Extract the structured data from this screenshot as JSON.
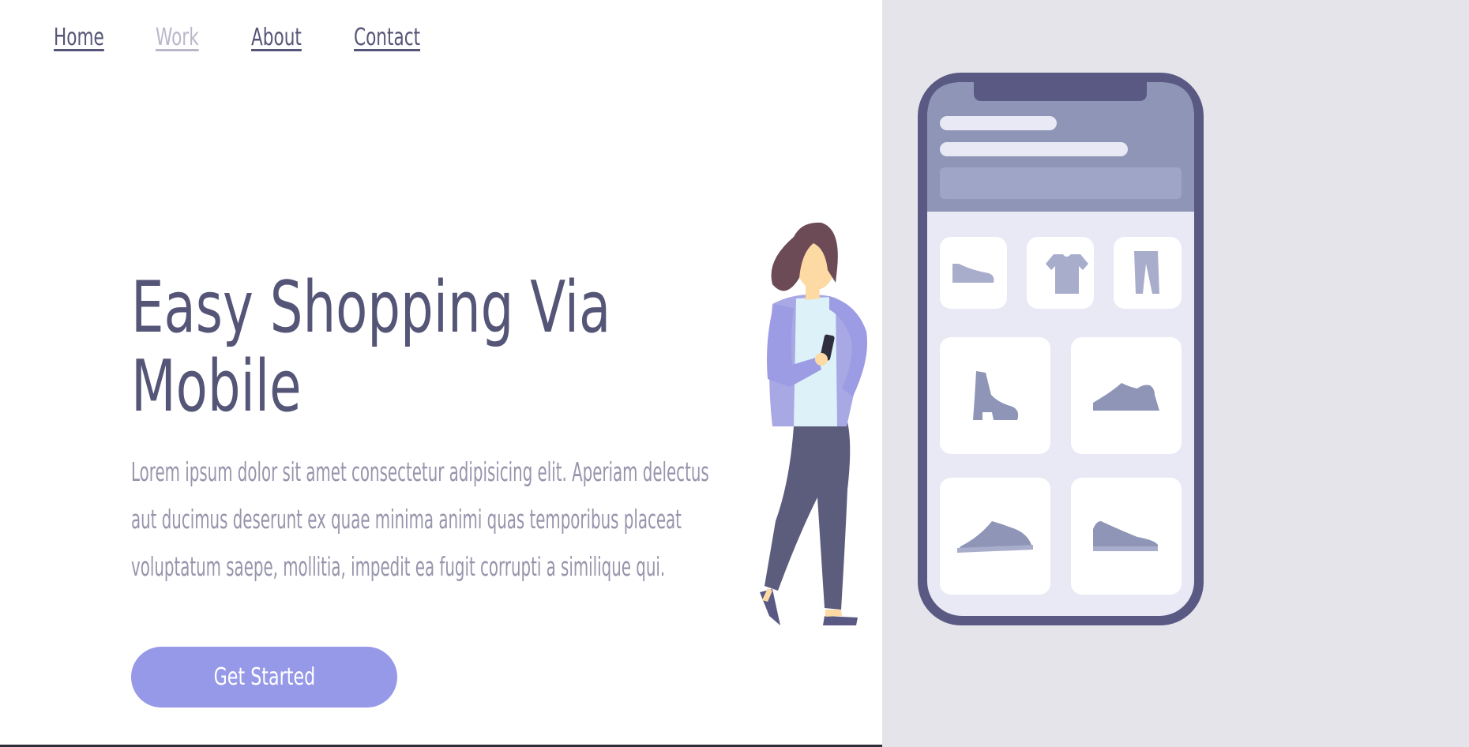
{
  "nav": {
    "items": [
      {
        "label": "Home",
        "active": false
      },
      {
        "label": "Work",
        "active": true
      },
      {
        "label": "About",
        "active": false
      },
      {
        "label": "Contact",
        "active": false
      }
    ]
  },
  "hero": {
    "title": "Easy Shopping Via Mobile",
    "text": "Lorem ipsum dolor sit amet consectetur adipisicing elit. Aperiam delectus aut ducimus deserunt ex quae minima animi quas temporibus placeat voluptatum saepe, mollitia, impedit ea fugit corrupti a similique qui.",
    "cta_label": "Get Started"
  },
  "colors": {
    "primary_text": "#555577",
    "muted_text": "#9795ac",
    "nav_active": "#b9b8cb",
    "accent": "#9698e8",
    "panel_bg": "#e5e4ea",
    "phone_frame": "#595983"
  },
  "illustration": {
    "icons": [
      "flat-shoe-icon",
      "tshirt-icon",
      "pants-icon",
      "boot-icon",
      "sneaker-icon",
      "sneaker-icon",
      "sneaker-icon"
    ]
  }
}
